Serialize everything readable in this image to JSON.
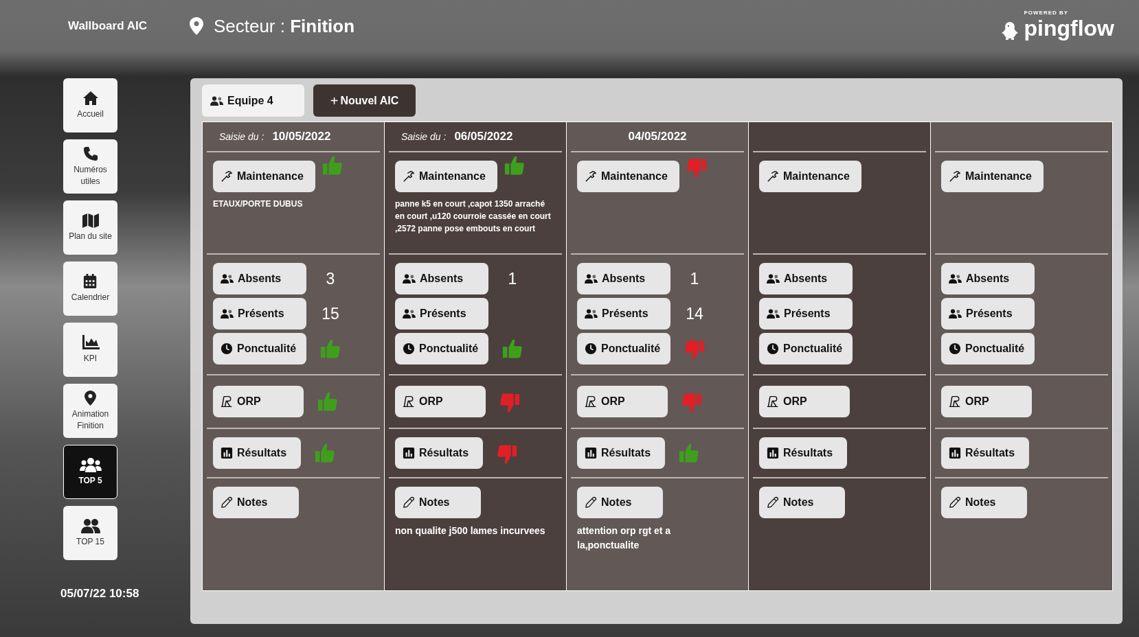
{
  "header": {
    "app_title": "Wallboard AIC",
    "sector_label": "Secteur :",
    "sector_name": "Finition",
    "powered_by": "POWERED BY",
    "brand": "pingflow"
  },
  "nav": [
    {
      "label": "Accueil",
      "kind": "home",
      "selected": false
    },
    {
      "label": "Numéros utiles",
      "kind": "phone",
      "selected": false
    },
    {
      "label": "Plan du site",
      "kind": "map",
      "selected": false
    },
    {
      "label": "Calendrier",
      "kind": "calendar",
      "selected": false
    },
    {
      "label": "KPI",
      "kind": "chart",
      "selected": false
    },
    {
      "label": "Animation Finition",
      "kind": "pin",
      "selected": false
    },
    {
      "label": "TOP 5",
      "kind": "group",
      "selected": true
    },
    {
      "label": "TOP 15",
      "kind": "users",
      "selected": false
    }
  ],
  "datetime": "05/07/22 10:58",
  "toolbar": [
    {
      "label": "Equipe 4",
      "kind": "team"
    },
    {
      "label": "Nouvel AIC",
      "symbol": "+",
      "kind": "add"
    }
  ],
  "columns": [
    {
      "saisie_label": "Saisie du :",
      "date": "10/05/2022",
      "maintenance": {
        "label": "Maintenance",
        "positive": true,
        "note": "ETAUX/PORTE DUBUS"
      },
      "absents": {
        "label": "Absents",
        "count": "3"
      },
      "presents": {
        "label": "Présents",
        "count": "15"
      },
      "ponctualite": {
        "label": "Ponctualité",
        "positive": true
      },
      "orp": {
        "label": "ORP",
        "positive": true
      },
      "resultats": {
        "label": "Résultats",
        "positive": true
      },
      "notes": {
        "label": "Notes"
      }
    },
    {
      "saisie_label": "Saisie du :",
      "date": "06/05/2022",
      "maintenance": {
        "label": "Maintenance",
        "positive": true,
        "note": "panne k5 en court ,capot 1350 arraché en court ,u120 courroie cassée en court ,2572 panne pose embouts en court"
      },
      "absents": {
        "label": "Absents",
        "count": "1"
      },
      "presents": {
        "label": "Présents"
      },
      "ponctualite": {
        "label": "Ponctualité",
        "positive": true
      },
      "orp": {
        "label": "ORP",
        "positive": false
      },
      "resultats": {
        "label": "Résultats",
        "positive": false
      },
      "notes": {
        "label": "Notes",
        "text": "non qualite j500 lames incurvees"
      }
    },
    {
      "date": "04/05/2022",
      "maintenance": {
        "label": "Maintenance",
        "positive": false
      },
      "absents": {
        "label": "Absents",
        "count": "1"
      },
      "presents": {
        "label": "Présents",
        "count": "14"
      },
      "ponctualite": {
        "label": "Ponctualité",
        "positive": false
      },
      "orp": {
        "label": "ORP",
        "positive": false
      },
      "resultats": {
        "label": "Résultats",
        "positive": true
      },
      "notes": {
        "label": "Notes",
        "text": "attention orp rgt et a\nla,ponctualite"
      }
    },
    {
      "maintenance": {
        "label": "Maintenance"
      },
      "absents": {
        "label": "Absents"
      },
      "presents": {
        "label": "Présents"
      },
      "ponctualite": {
        "label": "Ponctualité"
      },
      "orp": {
        "label": "ORP"
      },
      "resultats": {
        "label": "Résultats"
      },
      "notes": {
        "label": "Notes"
      }
    },
    {
      "maintenance": {
        "label": "Maintenance"
      },
      "absents": {
        "label": "Absents"
      },
      "presents": {
        "label": "Présents"
      },
      "ponctualite": {
        "label": "Ponctualité"
      },
      "orp": {
        "label": "ORP"
      },
      "resultats": {
        "label": "Résultats"
      },
      "notes": {
        "label": "Notes"
      }
    }
  ]
}
